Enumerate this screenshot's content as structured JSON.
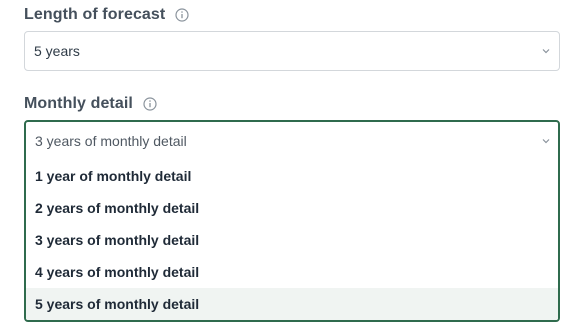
{
  "forecast": {
    "label": "Length of forecast",
    "value": "5 years"
  },
  "monthly": {
    "label": "Monthly detail",
    "value": "3 years of monthly detail",
    "options": [
      "1 year of monthly detail",
      "2 years of monthly detail",
      "3 years of monthly detail",
      "4 years of monthly detail",
      "5 years of monthly detail"
    ],
    "highlighted_option": "5 years of monthly detail"
  },
  "colors": {
    "accent_border": "#2f6b4d",
    "highlight_bg": "#f0f4f2"
  }
}
